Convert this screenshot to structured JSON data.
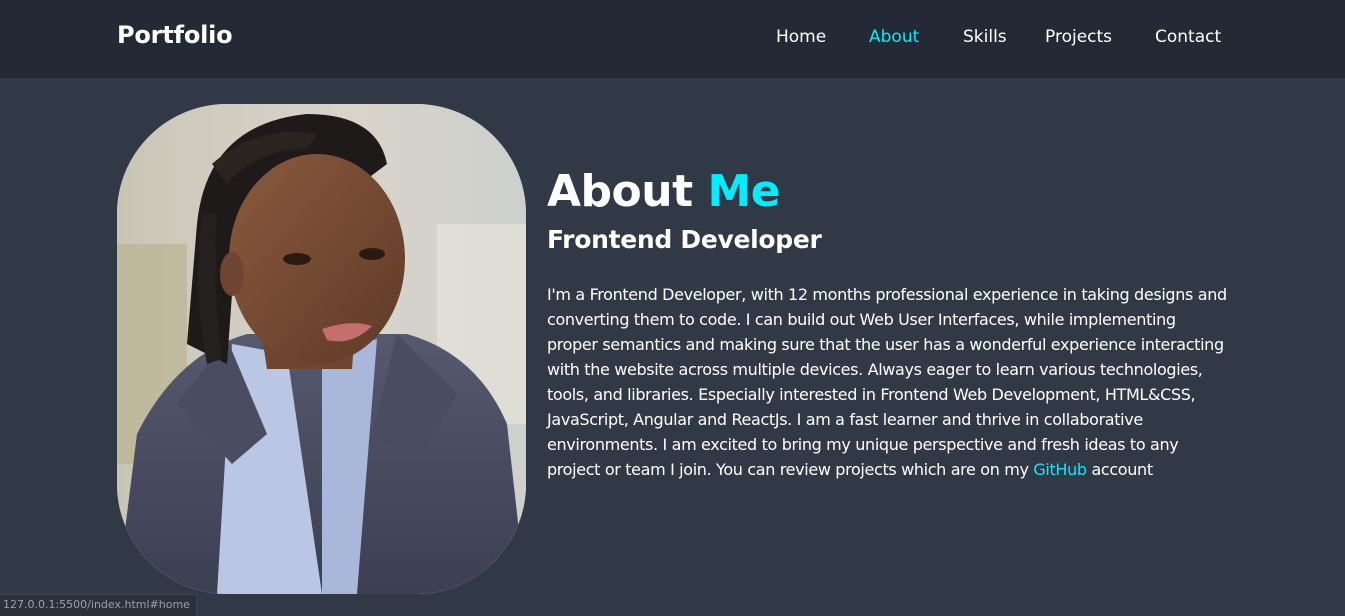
{
  "header": {
    "logo": "Portfolio",
    "nav": [
      {
        "label": "Home",
        "active": false
      },
      {
        "label": "About",
        "active": true
      },
      {
        "label": "Skills",
        "active": false
      },
      {
        "label": "Projects",
        "active": false
      },
      {
        "label": "Contact",
        "active": false
      }
    ]
  },
  "about": {
    "heading_main": "About",
    "heading_accent": "Me",
    "subheading": "Frontend Developer",
    "bio_text": "I'm a Frontend Developer, with 12 months professional experience in taking designs and converting them to code. I can build out Web User Interfaces, while implementing proper semantics and making sure that the user has a wonderful experience interacting with the website across multiple devices. Always eager to learn various technologies, tools, and libraries. Especially interested in Frontend Web Development, HTML&CSS, JavaScript, Angular and ReactJs. I am a fast learner and thrive in collaborative environments. I am excited to bring my unique perspective and fresh ideas to any project or team I join. You can review projects which are on my",
    "bio_link": "GitHub",
    "bio_end": "account"
  },
  "status_bar": {
    "url": "127.0.0.1:5500/index.html#home"
  },
  "colors": {
    "accent": "#00eeff",
    "background": "#323946",
    "header_background": "#242a35",
    "text": "#ffffff"
  }
}
